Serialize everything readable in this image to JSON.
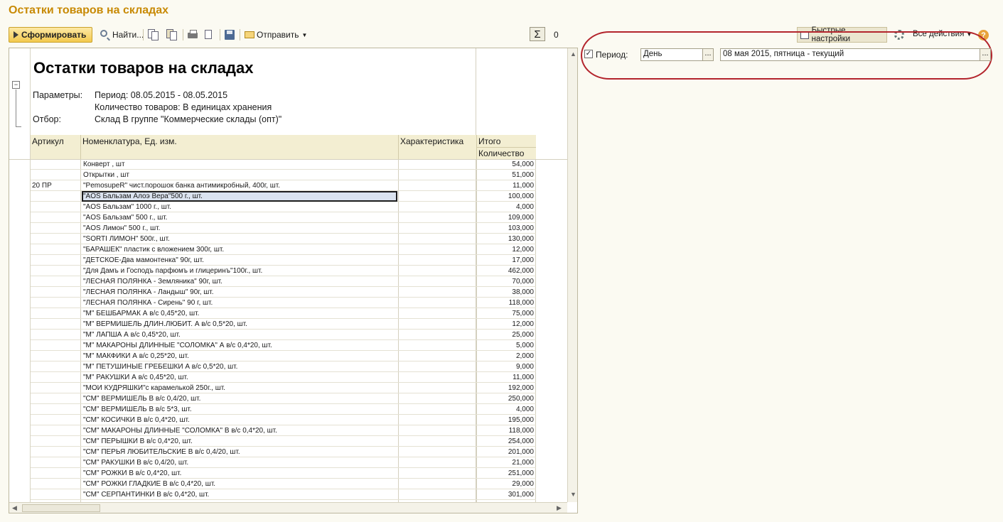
{
  "window": {
    "title": "Остатки товаров на складах"
  },
  "toolbar": {
    "generate_label": "Сформировать",
    "find_label": "Найти...",
    "send_label": "Отправить",
    "sum_value": "0"
  },
  "right_toolbar": {
    "quick_settings_label": "Быстрые настройки",
    "all_actions_label": "Все действия"
  },
  "period": {
    "label": "Период:",
    "checked": true,
    "granularity": "День",
    "value": "08 мая 2015, пятница - текущий",
    "ellipsis": "..."
  },
  "report": {
    "title": "Остатки товаров на складах",
    "params_label": "Параметры:",
    "params_period": "Период: 08.05.2015 - 08.05.2015",
    "params_qty": "Количество товаров: В единицах хранения",
    "filter_label": "Отбор:",
    "filter_value": "Склад В группе \"Коммерческие склады (опт)\"",
    "columns": {
      "article": "Артикул",
      "name": "Номенклатура, Ед. изм.",
      "characteristic": "Характеристика",
      "total": "Итого",
      "quantity": "Количество"
    },
    "rows": [
      {
        "article": "",
        "name": "Конверт  , шт",
        "qty": "54,000"
      },
      {
        "article": "",
        "name": "Открытки  , шт",
        "qty": "51,000"
      },
      {
        "article": "20 ПР",
        "name": "\"PemosupeR\" чист.порошок банка антимикробный, 400г, шт.",
        "qty": "11,000"
      },
      {
        "article": "",
        "name": "\"AOS Бальзам Алоэ Вера\"500 г., шт.",
        "qty": "100,000",
        "selected": true
      },
      {
        "article": "",
        "name": "\"AOS Бальзам\" 1000 г., шт.",
        "qty": "4,000"
      },
      {
        "article": "",
        "name": "\"AOS Бальзам\" 500 г., шт.",
        "qty": "109,000"
      },
      {
        "article": "",
        "name": "\"AOS Лимон\" 500 г., шт.",
        "qty": "103,000"
      },
      {
        "article": "",
        "name": "\"SORTI ЛИМОН\" 500г., шт.",
        "qty": "130,000"
      },
      {
        "article": "",
        "name": "\"БАРАШЕК\" пластик с вложением 300г, шт.",
        "qty": "12,000"
      },
      {
        "article": "",
        "name": "\"ДЕТСКОЕ-Два мамонтенка\" 90г, шт.",
        "qty": "17,000"
      },
      {
        "article": "",
        "name": "\"Для Дамъ и Господъ парфюмъ и глицеринъ\"100г., шт.",
        "qty": "462,000"
      },
      {
        "article": "",
        "name": "\"ЛЕСНАЯ ПОЛЯНКА - Земляника\" 90г, шт.",
        "qty": "70,000"
      },
      {
        "article": "",
        "name": "\"ЛЕСНАЯ ПОЛЯНКА - Ландыш\" 90г, шт.",
        "qty": "38,000"
      },
      {
        "article": "",
        "name": "\"ЛЕСНАЯ ПОЛЯНКА - Сирень\" 90 г, шт.",
        "qty": "118,000"
      },
      {
        "article": "",
        "name": "\"М\" БЕШБАРМАК А в/с 0,45*20, шт.",
        "qty": "75,000"
      },
      {
        "article": "",
        "name": "\"М\" ВЕРМИШЕЛЬ ДЛИН.ЛЮБИТ. А в/с 0,5*20, шт.",
        "qty": "12,000"
      },
      {
        "article": "",
        "name": "\"М\" ЛАПША А в/с 0,45*20, шт.",
        "qty": "25,000"
      },
      {
        "article": "",
        "name": "\"М\" МАКАРОНЫ ДЛИННЫЕ \"СОЛОМКА\" А в/с 0,4*20, шт.",
        "qty": "5,000"
      },
      {
        "article": "",
        "name": "\"М\" МАКФИКИ А в/с 0,25*20, шт.",
        "qty": "2,000"
      },
      {
        "article": "",
        "name": "\"М\" ПЕТУШИНЫЕ ГРЕБЕШКИ А в/с 0,5*20, шт.",
        "qty": "9,000"
      },
      {
        "article": "",
        "name": "\"М\" РАКУШКИ А в/с 0,45*20, шт.",
        "qty": "11,000"
      },
      {
        "article": "",
        "name": "\"МОИ КУДРЯШКИ\"с карамелькой 250г., шт.",
        "qty": "192,000"
      },
      {
        "article": "",
        "name": "\"СМ\" ВЕРМИШЕЛЬ В в/с 0,4/20, шт.",
        "qty": "250,000"
      },
      {
        "article": "",
        "name": "\"СМ\" ВЕРМИШЕЛЬ В в/с 5*3, шт.",
        "qty": "4,000"
      },
      {
        "article": "",
        "name": "\"СМ\" КОСИЧКИ В в/с 0,4*20, шт.",
        "qty": "195,000"
      },
      {
        "article": "",
        "name": "\"СМ\" МАКАРОНЫ ДЛИННЫЕ \"СОЛОМКА\" В в/с 0,4*20, шт.",
        "qty": "118,000"
      },
      {
        "article": "",
        "name": "\"СМ\" ПЕРЫШКИ В в/с 0,4*20, шт.",
        "qty": "254,000"
      },
      {
        "article": "",
        "name": "\"СМ\" ПЕРЬЯ ЛЮБИТЕЛЬСКИЕ В в/с 0,4/20, шт.",
        "qty": "201,000"
      },
      {
        "article": "",
        "name": "\"СМ\" РАКУШКИ В в/с 0,4/20, шт.",
        "qty": "21,000"
      },
      {
        "article": "",
        "name": "\"СМ\" РОЖКИ В в/с 0,4*20, шт.",
        "qty": "251,000"
      },
      {
        "article": "",
        "name": "\"СМ\" РОЖКИ ГЛАДКИЕ В в/с 0,4*20, шт.",
        "qty": "29,000"
      },
      {
        "article": "",
        "name": "\"СМ\" СЕРПАНТИНКИ В в/с 0,4*20, шт.",
        "qty": "301,000"
      }
    ]
  }
}
